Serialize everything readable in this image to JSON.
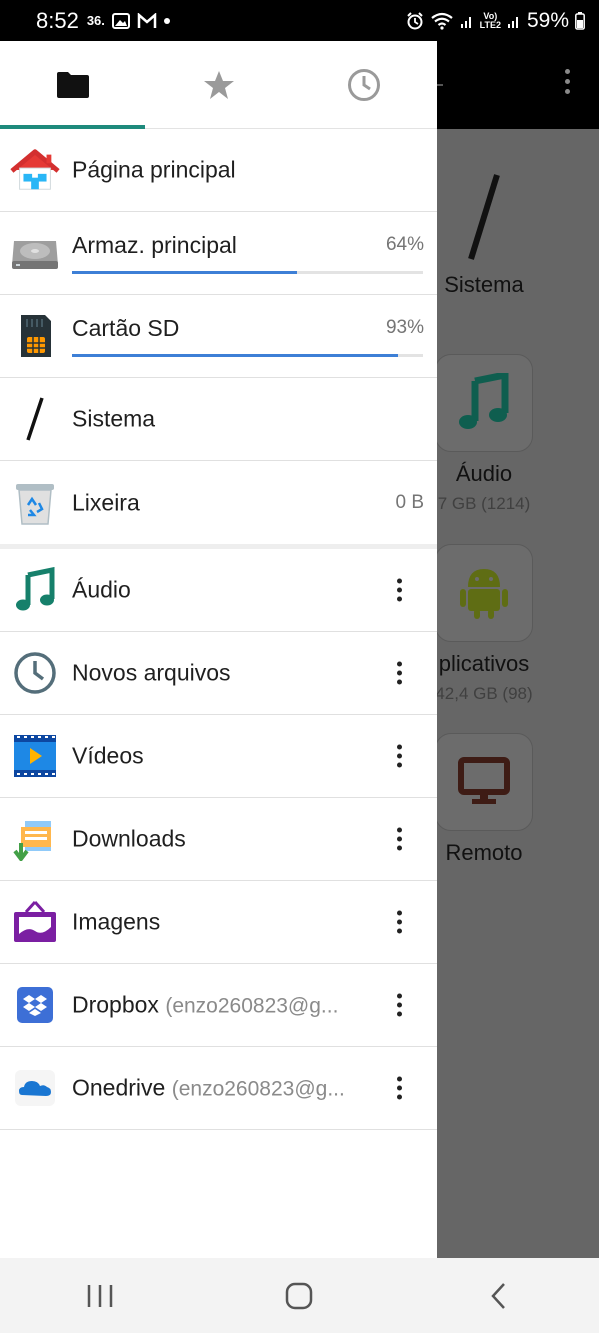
{
  "status_bar": {
    "time": "8:52",
    "left_text": "36.",
    "lte_label": "Vo)\nLTE2",
    "battery": "59%"
  },
  "tabs": [
    {
      "icon": "folder-icon",
      "active": true
    },
    {
      "icon": "star-icon",
      "active": false
    },
    {
      "icon": "clock-icon",
      "active": false
    }
  ],
  "drawer": {
    "locations": [
      {
        "icon": "home-icon",
        "label": "Página principal"
      },
      {
        "icon": "hard-drive-icon",
        "label": "Armaz. principal",
        "percent": "64%",
        "fill": 0.64
      },
      {
        "icon": "sd-card-icon",
        "label": "Cartão SD",
        "percent": "93%",
        "fill": 0.93
      },
      {
        "icon": "root-slash-icon",
        "label": "Sistema"
      },
      {
        "icon": "trash-icon",
        "label": "Lixeira",
        "size": "0 B"
      }
    ],
    "categories": [
      {
        "icon": "music-note-icon",
        "label": "Áudio",
        "sub": ""
      },
      {
        "icon": "clock-icon",
        "label": "Novos arquivos",
        "sub": ""
      },
      {
        "icon": "video-icon",
        "label": "Vídeos",
        "sub": ""
      },
      {
        "icon": "downloads-icon",
        "label": "Downloads",
        "sub": ""
      },
      {
        "icon": "image-icon",
        "label": "Imagens",
        "sub": ""
      },
      {
        "icon": "dropbox-icon",
        "label": "Dropbox",
        "sub": "(enzo260823@g..."
      },
      {
        "icon": "onedrive-icon",
        "label": "Onedrive",
        "sub": "(enzo260823@g..."
      }
    ]
  },
  "background": {
    "sistema_label": "Sistema",
    "audio_label": "Áudio",
    "audio_sub": "7 GB (1214)",
    "apps_label": "plicativos",
    "apps_sub": "42,4 GB (98)",
    "remote_label": "Remoto"
  },
  "colors": {
    "accent": "#1e8a7c",
    "progress": "#3d7fd6",
    "audio_green": "#16806b",
    "android_green": "#7b8a1a",
    "remote_brown": "#5a2a20"
  }
}
